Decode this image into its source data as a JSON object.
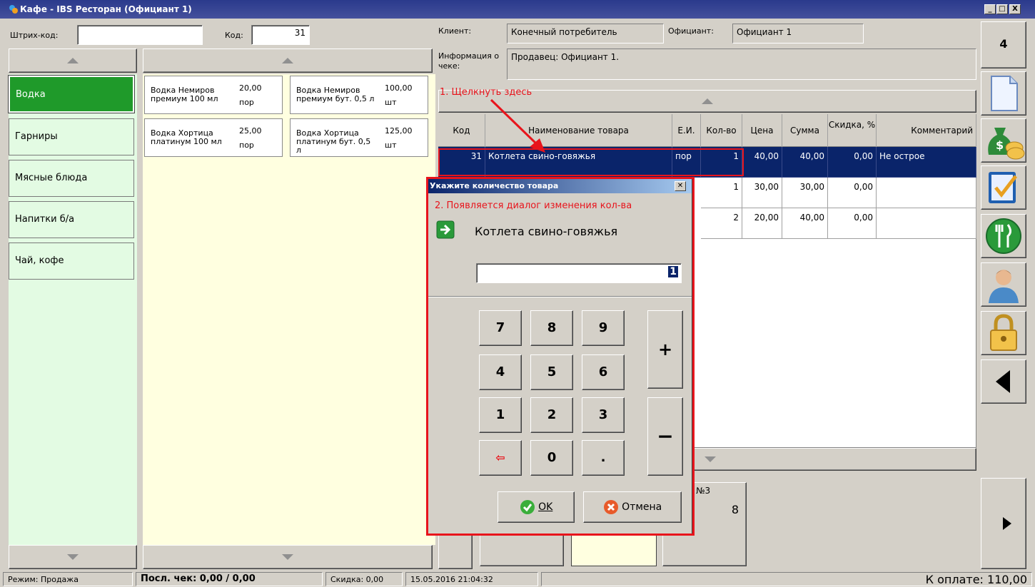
{
  "window": {
    "title": "Кафе - IBS Ресторан (Официант 1)",
    "controls": [
      "_",
      "□",
      "X"
    ]
  },
  "top": {
    "barcode_label": "Штрих-код:",
    "barcode_value": "",
    "code_label": "Код:",
    "code_value": "31",
    "client_label": "Клиент:",
    "client_value": "Конечный потребитель",
    "waiter_label": "Официант:",
    "waiter_value": "Официант 1",
    "receipt_info_label": "Информация о чеке:",
    "receipt_info_value": "Продавец: Официант 1.",
    "counter": "4"
  },
  "categories": [
    {
      "label": "Водка",
      "selected": true
    },
    {
      "label": "Гарниры"
    },
    {
      "label": "Мясные блюда"
    },
    {
      "label": "Напитки б/а"
    },
    {
      "label": "Чай, кофе"
    }
  ],
  "products": [
    {
      "name": "Водка Немиров премиум 100 мл",
      "price": "20,00",
      "unit": "пор"
    },
    {
      "name": "Водка Немиров премиум бут. 0,5 л",
      "price": "100,00",
      "unit": "шт"
    },
    {
      "name": "Водка Хортица платинум 100 мл",
      "price": "25,00",
      "unit": "пор"
    },
    {
      "name": "Водка Хортица платинум бут. 0,5 л",
      "price": "125,00",
      "unit": "шт"
    }
  ],
  "annotations": {
    "step1": "1. Щелкнуть здесь",
    "step2": "2. Появляется диалог изменения кол-ва"
  },
  "table": {
    "columns": [
      "Код",
      "Наименование товара",
      "Е.И.",
      "Кол-во",
      "Цена",
      "Сумма",
      "Скидка, %",
      "Комментарий"
    ],
    "rows": [
      {
        "code": "31",
        "name": "Котлета свино-говяжья",
        "unit": "пор",
        "qty": "1",
        "price": "40,00",
        "sum": "40,00",
        "discount": "0,00",
        "comment": "Не острое"
      },
      {
        "code": "",
        "name": "",
        "unit": "",
        "qty": "1",
        "price": "30,00",
        "sum": "30,00",
        "discount": "0,00",
        "comment": ""
      },
      {
        "code": "",
        "name": "",
        "unit": "",
        "qty": "2",
        "price": "20,00",
        "sum": "40,00",
        "discount": "0,00",
        "comment": ""
      }
    ]
  },
  "tables_panel": {
    "label": "№3",
    "value": "8"
  },
  "dialog": {
    "title": "Укажите количество товара",
    "product": "Котлета свино-говяжья",
    "qty_value": "1",
    "keys": [
      "7",
      "8",
      "9",
      "4",
      "5",
      "6",
      "1",
      "2",
      "3",
      "⇦",
      "0",
      "."
    ],
    "plus": "+",
    "minus": "−",
    "ok_label": "OK",
    "cancel_label": "Отмена"
  },
  "status": {
    "mode": "Режим: Продажа",
    "last_receipt": "Посл. чек: 0,00 / 0,00",
    "discount": "Скидка: 0,00",
    "datetime": "15.05.2016 21:04:32",
    "to_pay": "К оплате: 110,00"
  },
  "colors": {
    "title_bar": "#2a3a8c",
    "category_selected": "#1f9a2a",
    "category_bg": "#e3fbe3",
    "products_bg": "#ffffe0",
    "selected_row": "#0a246a",
    "annotation_red": "#e8141c"
  }
}
